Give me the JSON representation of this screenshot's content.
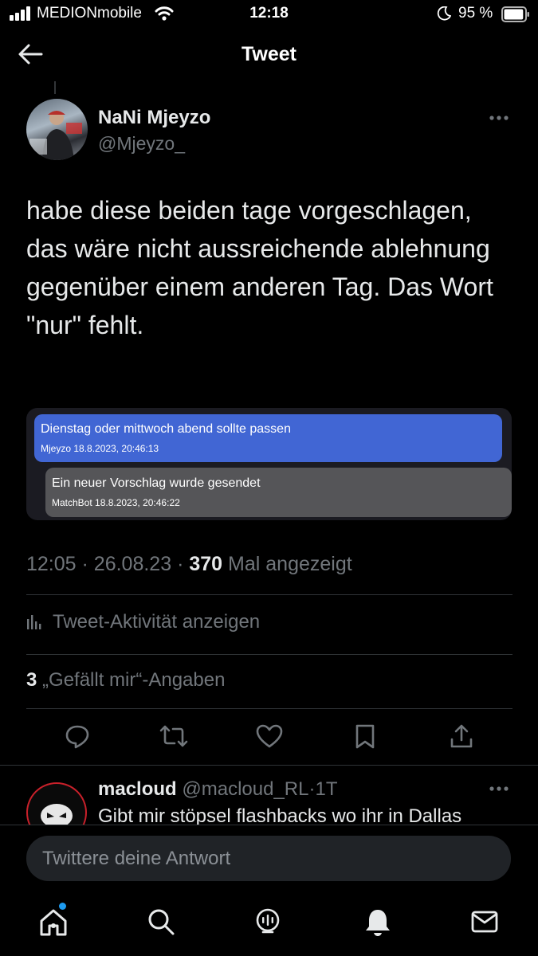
{
  "status_bar": {
    "carrier": "MEDIONmobile",
    "time": "12:18",
    "battery_percent": "95 %",
    "battery_level": 0.95
  },
  "header": {
    "title": "Tweet",
    "back_icon": "arrow-left-icon"
  },
  "tweet": {
    "author_name": "NaNi Mjeyzo",
    "author_handle": "@Mjeyzo_",
    "text": "habe diese beiden tage vorgeschlagen, das wäre nicht aussreichende ablehnung gegenüber einem anderen Tag. Das Wort \"nur\" fehlt.",
    "media": {
      "messages": [
        {
          "text": "Dienstag oder mittwoch abend sollte passen",
          "meta": "Mjeyzo 18.8.2023, 20:46:13",
          "color": "#4166d4"
        },
        {
          "text": "Ein neuer Vorschlag wurde gesendet",
          "meta": "MatchBot 18.8.2023, 20:46:22",
          "color": "#555558"
        }
      ]
    },
    "time": "12:05",
    "date": "26.08.23",
    "separator": "·",
    "views_count": "370",
    "views_label": "Mal angezeigt",
    "activity_label": "Tweet-Aktivität anzeigen",
    "likes_count": "3",
    "likes_label": "„Gefällt mir“-Angaben"
  },
  "actions": [
    "reply-icon",
    "retweet-icon",
    "like-icon",
    "bookmark-icon",
    "share-icon"
  ],
  "reply": {
    "name": "macloud",
    "handle": "@macloud_RL",
    "age": "1T",
    "text": "Gibt mir stöpsel flashbacks wo ihr in Dallas"
  },
  "composer": {
    "placeholder": "Twittere deine Antwort"
  },
  "tab_bar": [
    "home-icon",
    "search-icon",
    "spaces-icon",
    "notifications-icon",
    "messages-icon"
  ],
  "colors": {
    "background": "#000000",
    "text": "#e7e9ea",
    "muted": "#71767b",
    "accent": "#1d9bf0",
    "divider": "#2f3336"
  }
}
